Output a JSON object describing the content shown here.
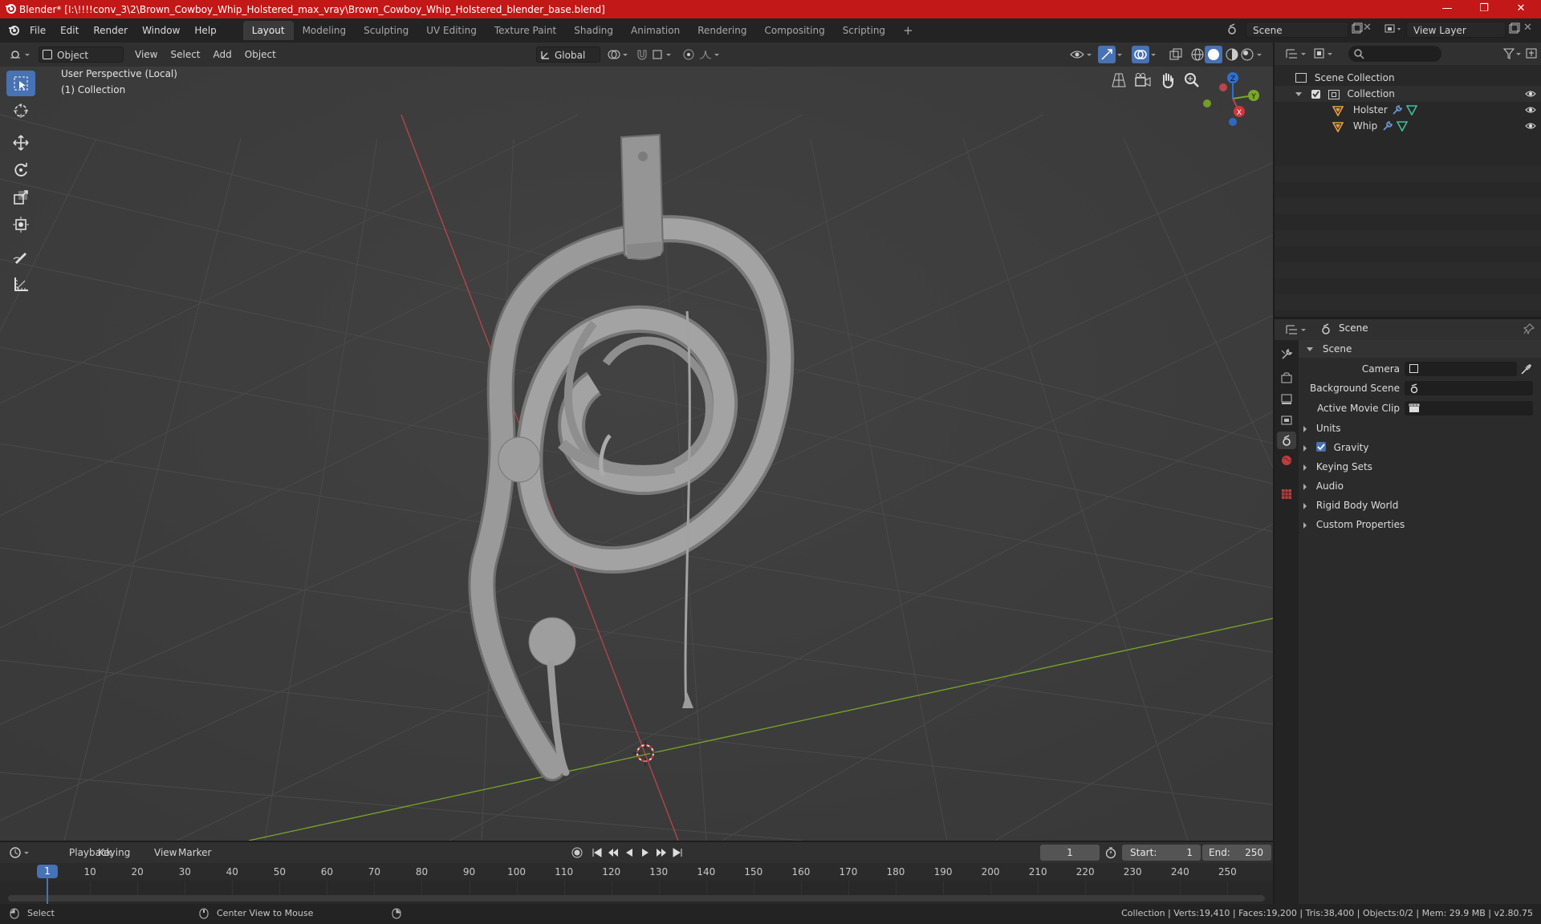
{
  "window": {
    "title": "Blender* [I:\\!!!!conv_3\\2\\Brown_Cowboy_Whip_Holstered_max_vray\\Brown_Cowboy_Whip_Holstered_blender_base.blend]",
    "minimize": "—",
    "maximize": "❐",
    "close": "✕"
  },
  "menubar": {
    "items": [
      "File",
      "Edit",
      "Render",
      "Window",
      "Help"
    ],
    "workspaces": [
      "Layout",
      "Modeling",
      "Sculpting",
      "UV Editing",
      "Texture Paint",
      "Shading",
      "Animation",
      "Rendering",
      "Compositing",
      "Scripting"
    ],
    "add_workspace": "+",
    "scene_name": "Scene",
    "view_layer": "View Layer"
  },
  "viewport_header": {
    "mode": "Object Mode",
    "menus": [
      "View",
      "Select",
      "Add",
      "Object"
    ],
    "orientation": "Global"
  },
  "viewport": {
    "perspective_label": "User Perspective (Local)",
    "collection_label": "(1) Collection",
    "gizmo": {
      "z": "Z",
      "y": "Y",
      "x": "X"
    }
  },
  "outliner": {
    "root": "Scene Collection",
    "collection": "Collection",
    "objects": [
      "Holster",
      "Whip"
    ]
  },
  "properties": {
    "header_title": "Scene",
    "section": "Scene",
    "fields": [
      {
        "label": "Camera",
        "value": ""
      },
      {
        "label": "Background Scene",
        "value": ""
      },
      {
        "label": "Active Movie Clip",
        "value": ""
      }
    ],
    "panels": [
      "Units",
      "Gravity",
      "Keying Sets",
      "Audio",
      "Rigid Body World",
      "Custom Properties"
    ],
    "gravity_checked": true
  },
  "timeline": {
    "menus": [
      "Playback",
      "Keying",
      "View",
      "Marker"
    ],
    "current_frame": "1",
    "start_label": "Start:",
    "start": "1",
    "end_label": "End:",
    "end": "250",
    "ticks": [
      "1",
      "10",
      "20",
      "30",
      "40",
      "50",
      "60",
      "70",
      "80",
      "90",
      "100",
      "110",
      "120",
      "130",
      "140",
      "150",
      "160",
      "170",
      "180",
      "190",
      "200",
      "210",
      "220",
      "230",
      "240",
      "250"
    ]
  },
  "statusbar": {
    "left": "Select",
    "middle": "Center View to Mouse",
    "stats": "Collection | Verts:19,410 | Faces:19,200 | Tris:38,400 | Objects:0/2 | Mem: 29.9 MB | v2.80.75"
  },
  "colors": {
    "titlebar": "#c21818",
    "active_tool": "#4772b3",
    "x_axis": "#b8464a",
    "y_axis": "#7aa62a",
    "z_axis": "#2f6fd0",
    "frame_marker": "#4772b3"
  }
}
